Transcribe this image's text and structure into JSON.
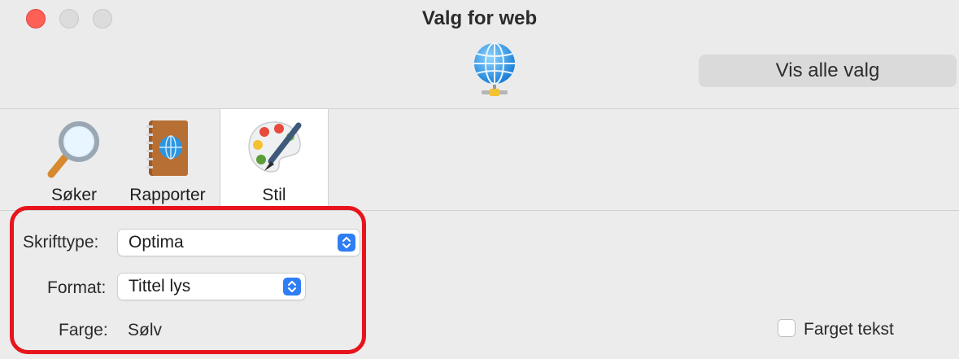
{
  "window": {
    "title": "Valg for web"
  },
  "toolbar": {
    "show_all_label": "Vis alle valg",
    "globe_icon": "globe-network-icon"
  },
  "tabs": [
    {
      "label": "Søker",
      "icon": "magnifier-icon"
    },
    {
      "label": "Rapporter",
      "icon": "notebook-globe-icon"
    },
    {
      "label": "Stil",
      "icon": "palette-brush-icon",
      "selected": true
    }
  ],
  "style_panel": {
    "font_label": "Skrifttype:",
    "font_value": "Optima",
    "format_label": "Format:",
    "format_value": "Tittel lys",
    "color_label": "Farge:",
    "color_value": "Sølv",
    "colored_text_label": "Farget tekst",
    "colored_text_checked": false
  },
  "colors": {
    "highlight": "#e8141c",
    "accent": "#2f7ef6",
    "close": "#fe5f57"
  }
}
